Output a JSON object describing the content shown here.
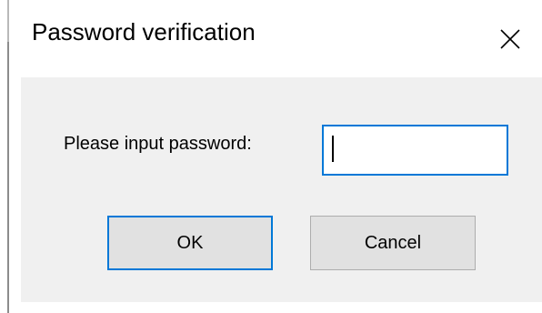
{
  "window": {
    "title": "Password verification",
    "close_icon": "close-icon"
  },
  "form": {
    "prompt_label": "Please input password:",
    "password_value": ""
  },
  "buttons": {
    "ok_label": "OK",
    "cancel_label": "Cancel"
  },
  "colors": {
    "accent": "#0078d7",
    "dialog_background": "#f0f0f0",
    "button_background": "#e1e1e1",
    "button_border": "#adadad"
  }
}
